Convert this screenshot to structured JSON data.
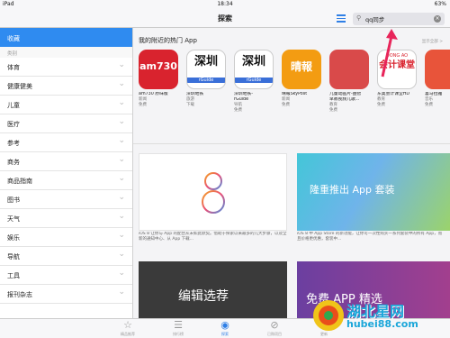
{
  "status": {
    "device": "iPad",
    "time": "18:34",
    "battery": "63%"
  },
  "nav": {
    "title": "探索",
    "search_value": "qq同步"
  },
  "sidebar": {
    "header": "收藏",
    "category_label": "类别",
    "items": [
      "体育",
      "健康健美",
      "儿童",
      "医疗",
      "参考",
      "商务",
      "商品指南",
      "图书",
      "天气",
      "娱乐",
      "导航",
      "工具",
      "报刊杂志"
    ]
  },
  "section": {
    "title": "我的附近的热门 App",
    "more": "显示全部 >"
  },
  "apps": [
    {
      "name": "am730 原味版",
      "category": "新闻",
      "price": "免费",
      "icon_text": "am730"
    },
    {
      "name": "深圳地铁",
      "category": "旅游",
      "price": "下载",
      "icon_text": "深圳",
      "icon_sub": "rGuide"
    },
    {
      "name": "深圳地铁-",
      "name2": "rGuide",
      "category": "导航",
      "price": "免费",
      "icon_text": "深圳",
      "icon_sub": "rGuide"
    },
    {
      "name": "晴報SkyPost",
      "category": "新闻",
      "price": "免费",
      "icon_text": "晴報"
    },
    {
      "name": "儿童动画片-益智",
      "name2": "早教视频儿歌...",
      "category": "教育",
      "price": "免费",
      "icon_text": ""
    },
    {
      "name": "东奥会计课堂HD",
      "category": "教育",
      "price": "免费",
      "icon_top": "DONG AO",
      "icon_text": "会计课堂"
    },
    {
      "name": "喜马拉雅",
      "category": "音乐",
      "price": "免费",
      "icon_text": ""
    }
  ],
  "banners": {
    "ios8_caption": "iOS 8 让你与 App 的配合从未如此默契。借助于探索以来最多的几大步骤，以及全新的通知中心、从 App 下载...",
    "bundle_title": "隆重推出 App 套装",
    "bundle_caption": "iOS 8 中 App Store 的新功能，让你可一次性购买一系列套装中的所有 App，而且价格更优惠，套装中...",
    "editor_title": "编辑选荐",
    "free_title": "免费 APP 精选"
  },
  "tabs": [
    {
      "label": "精品推荐",
      "icon": "star-icon"
    },
    {
      "label": "排行榜",
      "icon": "list-icon"
    },
    {
      "label": "探索",
      "icon": "compass-icon",
      "active": true
    },
    {
      "label": "已购项目",
      "icon": "purchased-icon"
    },
    {
      "label": "更新",
      "icon": "update-icon"
    }
  ],
  "watermark": {
    "text": "湖北星网",
    "url": "hubei88.com"
  },
  "colors": {
    "accent": "#2f8bf0",
    "annotation_arrow": "#e8255a"
  }
}
